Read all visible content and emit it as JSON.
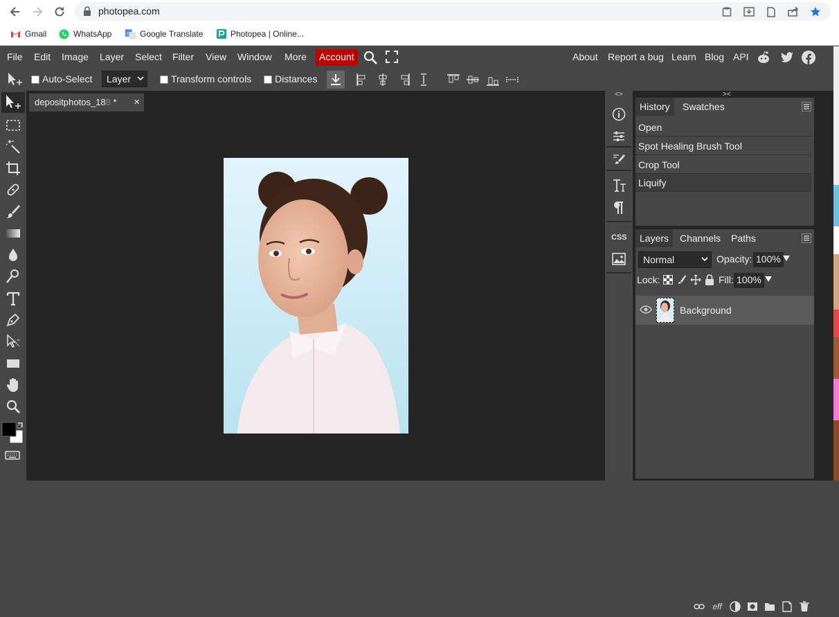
{
  "browser": {
    "url": "photopea.com",
    "bookmarks": [
      {
        "label": "Gmail",
        "icon": "gmail-icon"
      },
      {
        "label": "WhatsApp",
        "icon": "whatsapp-icon"
      },
      {
        "label": "Google Translate",
        "icon": "google-translate-icon"
      },
      {
        "label": "Photopea | Online...",
        "icon": "photopea-icon"
      }
    ]
  },
  "menubar": {
    "items": [
      "File",
      "Edit",
      "Image",
      "Layer",
      "Select",
      "Filter",
      "View",
      "Window",
      "More"
    ],
    "account": "Account",
    "right_items": [
      "About",
      "Report a bug",
      "Learn",
      "Blog",
      "API"
    ],
    "account_color": "#c00000"
  },
  "options": {
    "auto_select": "Auto-Select",
    "layer_select": "Layer",
    "transform_controls": "Transform controls",
    "distances": "Distances"
  },
  "document": {
    "tab_title": "depositphotos_18",
    "tab_title_faded": "8",
    "modified_marker": "*",
    "close": "×"
  },
  "history_panel": {
    "tabs": [
      "History",
      "Swatches"
    ],
    "items": [
      "Open",
      "Spot Healing Brush Tool",
      "Crop Tool",
      "Liquify"
    ]
  },
  "layers_panel": {
    "tabs": [
      "Layers",
      "Channels",
      "Paths"
    ],
    "blend_mode": "Normal",
    "opacity_label": "Opacity:",
    "opacity_value": "100%",
    "lock_label": "Lock:",
    "fill_label": "Fill:",
    "fill_value": "100%",
    "layers": [
      {
        "name": "Background"
      }
    ],
    "footer_eff": "eff"
  },
  "icon_strip": {
    "css_label": "CSS"
  }
}
